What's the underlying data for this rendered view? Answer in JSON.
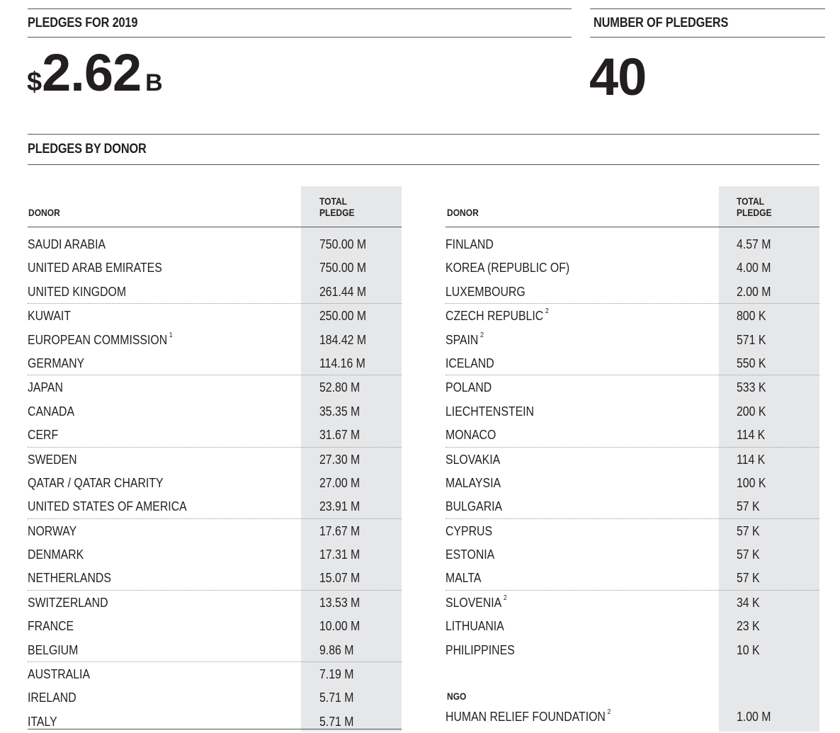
{
  "pledges_stat": {
    "label": "PLEDGES FOR 2019",
    "currency": "$",
    "amount": "2.62",
    "unit": "B"
  },
  "pledgers_stat": {
    "label": "NUMBER OF PLEDGERS",
    "count": "40"
  },
  "section_title": "PLEDGES BY DONOR",
  "table_headers": {
    "donor": "DONOR",
    "total_line1": "TOTAL",
    "total_line2": "PLEDGE"
  },
  "left_table": [
    {
      "donor": "SAUDI ARABIA",
      "note": "",
      "pledge": "750.00 M"
    },
    {
      "donor": "UNITED ARAB EMIRATES",
      "note": "",
      "pledge": "750.00 M"
    },
    {
      "donor": "UNITED KINGDOM",
      "note": "",
      "pledge": "261.44 M"
    },
    {
      "donor": "KUWAIT",
      "note": "",
      "pledge": "250.00 M"
    },
    {
      "donor": "EUROPEAN COMMISSION",
      "note": "1",
      "pledge": "184.42 M"
    },
    {
      "donor": "GERMANY",
      "note": "",
      "pledge": "114.16 M"
    },
    {
      "donor": "JAPAN",
      "note": "",
      "pledge": "52.80 M"
    },
    {
      "donor": "CANADA",
      "note": "",
      "pledge": "35.35 M"
    },
    {
      "donor": "CERF",
      "note": "",
      "pledge": "31.67 M"
    },
    {
      "donor": "SWEDEN",
      "note": "",
      "pledge": "27.30 M"
    },
    {
      "donor": "QATAR / QATAR CHARITY",
      "note": "",
      "pledge": "27.00 M"
    },
    {
      "donor": "UNITED STATES OF AMERICA",
      "note": "",
      "pledge": "23.91 M"
    },
    {
      "donor": "NORWAY",
      "note": "",
      "pledge": "17.67 M"
    },
    {
      "donor": "DENMARK",
      "note": "",
      "pledge": "17.31 M"
    },
    {
      "donor": "NETHERLANDS",
      "note": "",
      "pledge": "15.07 M"
    },
    {
      "donor": "SWITZERLAND",
      "note": "",
      "pledge": "13.53 M"
    },
    {
      "donor": "FRANCE",
      "note": "",
      "pledge": "10.00 M"
    },
    {
      "donor": "BELGIUM",
      "note": "",
      "pledge": "9.86 M"
    },
    {
      "donor": "AUSTRALIA",
      "note": "",
      "pledge": "7.19 M"
    },
    {
      "donor": "IRELAND",
      "note": "",
      "pledge": "5.71 M"
    },
    {
      "donor": "ITALY",
      "note": "",
      "pledge": "5.71 M"
    }
  ],
  "right_table": [
    {
      "donor": "FINLAND",
      "note": "",
      "pledge": "4.57 M"
    },
    {
      "donor": "KOREA (REPUBLIC OF)",
      "note": "",
      "pledge": "4.00 M"
    },
    {
      "donor": "LUXEMBOURG",
      "note": "",
      "pledge": "2.00 M"
    },
    {
      "donor": "CZECH REPUBLIC",
      "note": "2",
      "pledge": "800 K"
    },
    {
      "donor": "SPAIN",
      "note": "2",
      "pledge": "571 K"
    },
    {
      "donor": "ICELAND",
      "note": "",
      "pledge": "550 K"
    },
    {
      "donor": "POLAND",
      "note": "",
      "pledge": "533 K"
    },
    {
      "donor": "LIECHTENSTEIN",
      "note": "",
      "pledge": "200 K"
    },
    {
      "donor": "MONACO",
      "note": "",
      "pledge": "114 K"
    },
    {
      "donor": "SLOVAKIA",
      "note": "",
      "pledge": "114 K"
    },
    {
      "donor": "MALAYSIA",
      "note": "",
      "pledge": "100 K"
    },
    {
      "donor": "BULGARIA",
      "note": "",
      "pledge": "57 K"
    },
    {
      "donor": "CYPRUS",
      "note": "",
      "pledge": "57 K"
    },
    {
      "donor": "ESTONIA",
      "note": "",
      "pledge": "57 K"
    },
    {
      "donor": "MALTA",
      "note": "",
      "pledge": "57 K"
    },
    {
      "donor": "SLOVENIA",
      "note": "2",
      "pledge": "34 K"
    },
    {
      "donor": "LITHUANIA",
      "note": "",
      "pledge": "23 K"
    },
    {
      "donor": "PHILIPPINES",
      "note": "",
      "pledge": "10 K"
    }
  ],
  "ngo": {
    "label": "NGO",
    "rows": [
      {
        "donor": "HUMAN RELIEF FOUNDATION",
        "note": "2",
        "pledge": "1.00 M"
      }
    ]
  }
}
